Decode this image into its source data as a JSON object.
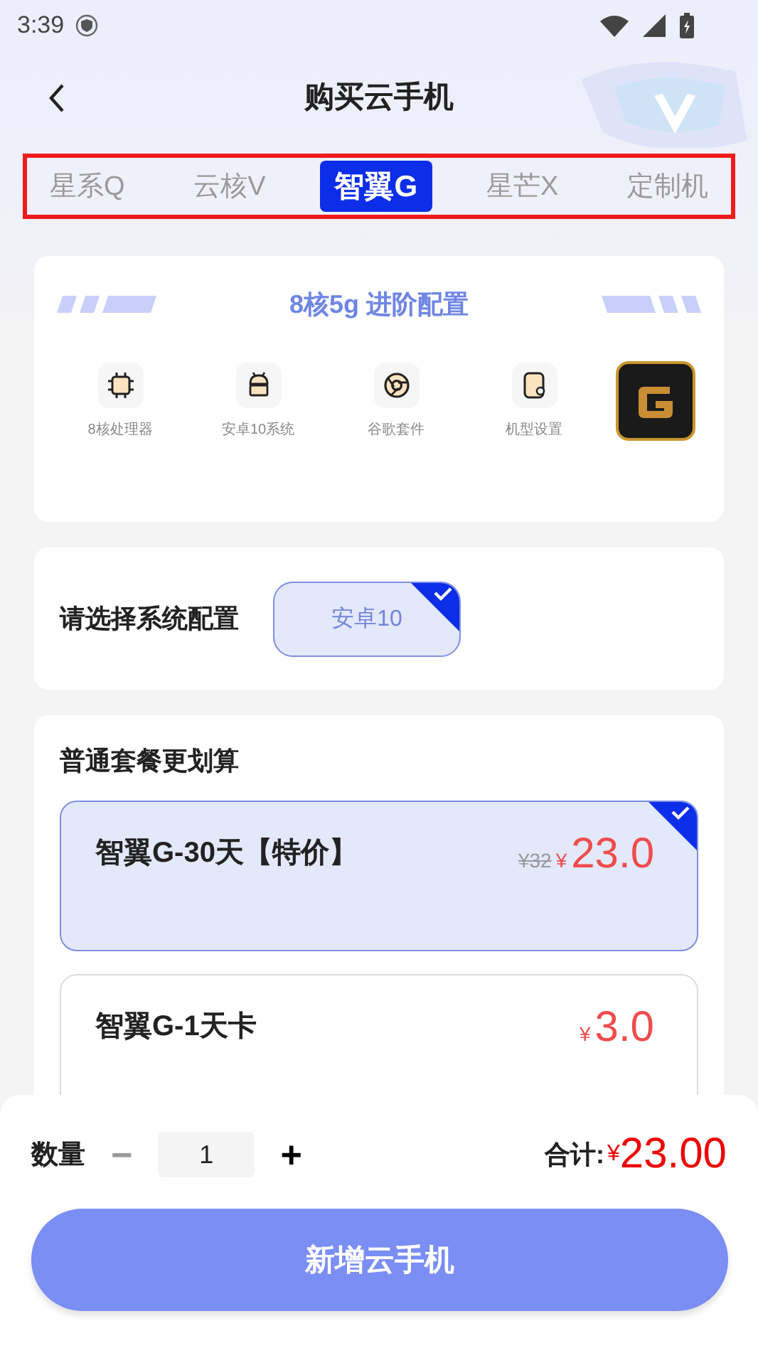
{
  "status_bar": {
    "time": "3:39"
  },
  "header": {
    "title": "购买云手机"
  },
  "tabs": [
    {
      "label": "星系Q",
      "selected": false
    },
    {
      "label": "云核V",
      "selected": false
    },
    {
      "label": "智翼G",
      "selected": true
    },
    {
      "label": "星芒X",
      "selected": false
    },
    {
      "label": "定制机",
      "selected": false
    }
  ],
  "config_card": {
    "title": "8核5g 进阶配置",
    "features": [
      {
        "label": "8核处理器"
      },
      {
        "label": "安卓10系统"
      },
      {
        "label": "谷歌套件"
      },
      {
        "label": "机型设置"
      }
    ]
  },
  "system_config": {
    "label": "请选择系统配置",
    "options": [
      {
        "label": "安卓10",
        "selected": true
      }
    ]
  },
  "plans": {
    "title": "普通套餐更划算",
    "items": [
      {
        "name": "智翼G-30天【特价】",
        "original_price": "¥32",
        "currency": "¥",
        "price": "23.0",
        "selected": true
      },
      {
        "name": "智翼G-1天卡",
        "currency": "¥",
        "price": "3.0",
        "selected": false
      }
    ]
  },
  "footer": {
    "quantity_label": "数量",
    "minus": "−",
    "quantity": "1",
    "plus": "+",
    "total_label": "合计:",
    "total_currency": "¥",
    "total": "23.00",
    "button": "新增云手机"
  }
}
